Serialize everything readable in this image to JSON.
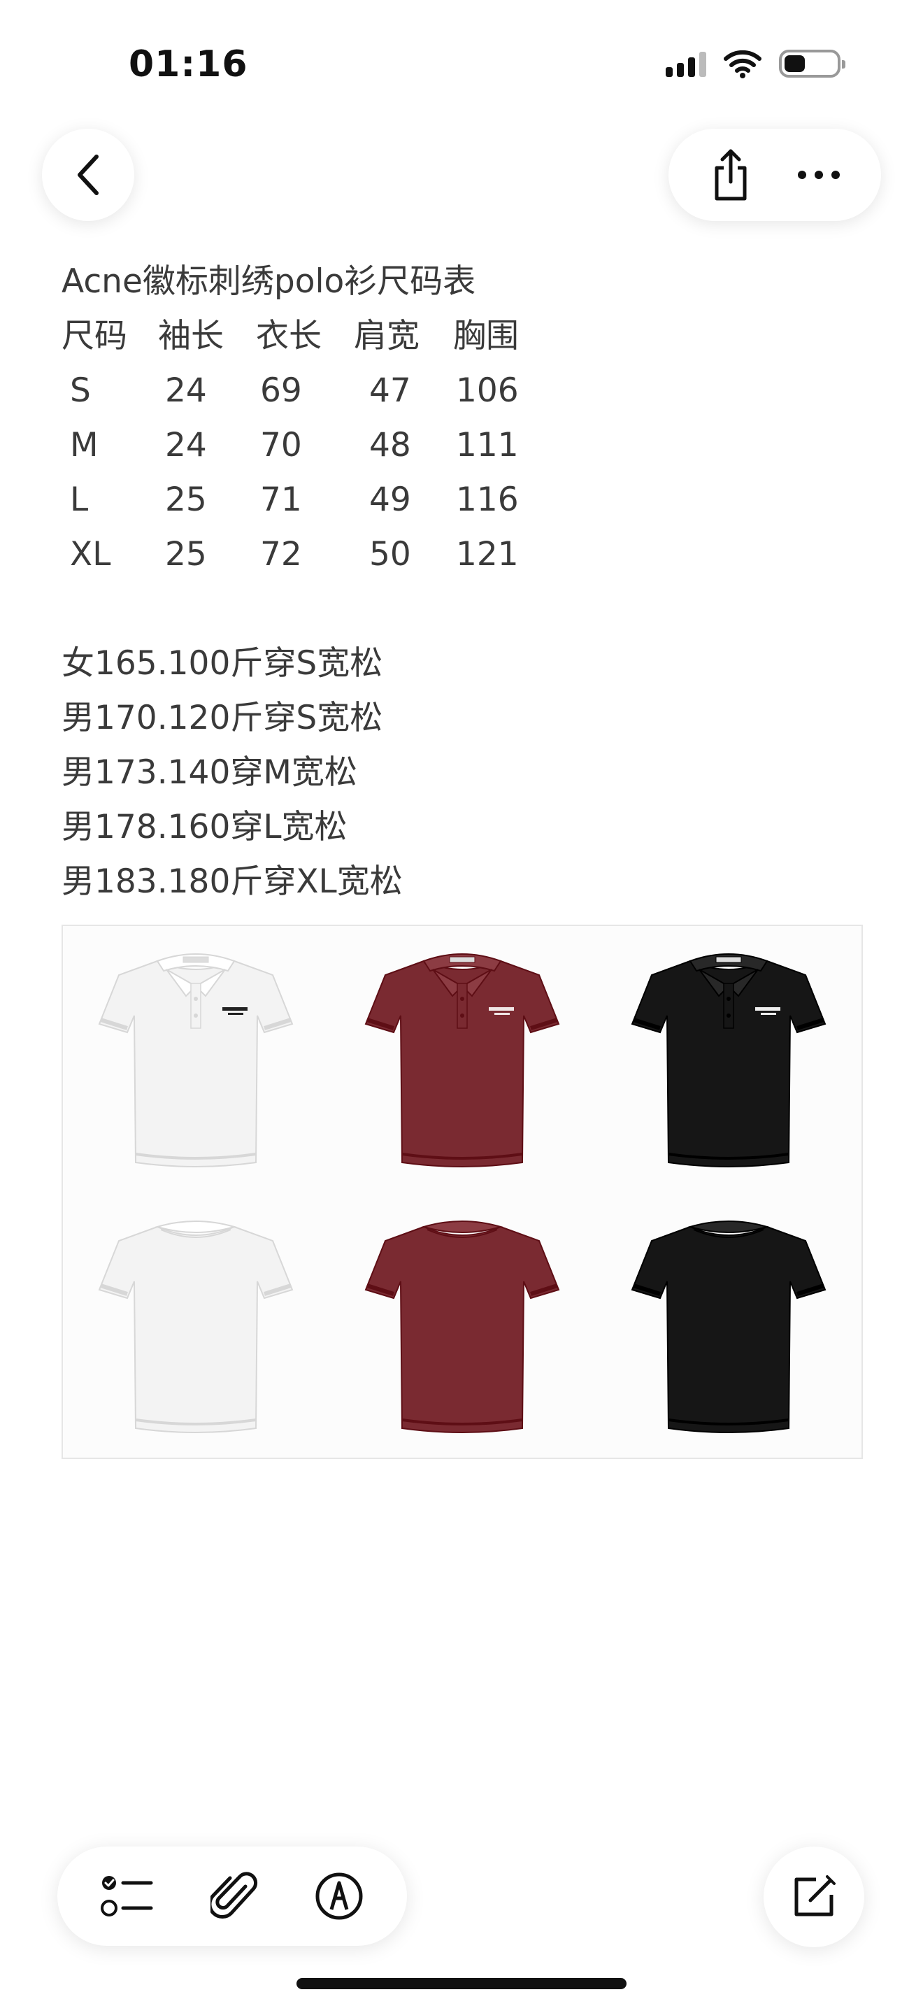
{
  "status_bar": {
    "time": "01:16",
    "icons": [
      "cellular-signal-icon",
      "wifi-icon",
      "battery-icon"
    ],
    "battery_level": 0.4
  },
  "nav": {
    "back_icon": "chevron-left-icon",
    "share_icon": "share-icon",
    "more_icon": "ellipsis-icon"
  },
  "note": {
    "title": "Acne徽标刺绣polo衫尺码表",
    "size_table": {
      "headers": [
        "尺码",
        "袖长",
        "衣长",
        "肩宽",
        "胸围"
      ],
      "rows": [
        [
          "S",
          "24",
          "69",
          "47",
          "106"
        ],
        [
          "M",
          "24",
          "70",
          "48",
          "111"
        ],
        [
          "L",
          "25",
          "71",
          "49",
          "116"
        ],
        [
          "XL",
          "25",
          "72",
          "50",
          "121"
        ]
      ]
    },
    "fit_notes": [
      "女165.100斤穿S宽松",
      "男170.120斤穿S宽松",
      "男173.140穿M宽松",
      "男178.160穿L宽松",
      "男183.180斤穿XL宽松"
    ]
  },
  "product_image": {
    "colors": [
      "#f3f3f3",
      "#7a2a31",
      "#161616"
    ],
    "views": [
      "front",
      "back"
    ]
  },
  "toolbar": {
    "icons": [
      "checklist-icon",
      "attachment-icon",
      "markup-icon"
    ],
    "compose_icon": "compose-icon"
  }
}
